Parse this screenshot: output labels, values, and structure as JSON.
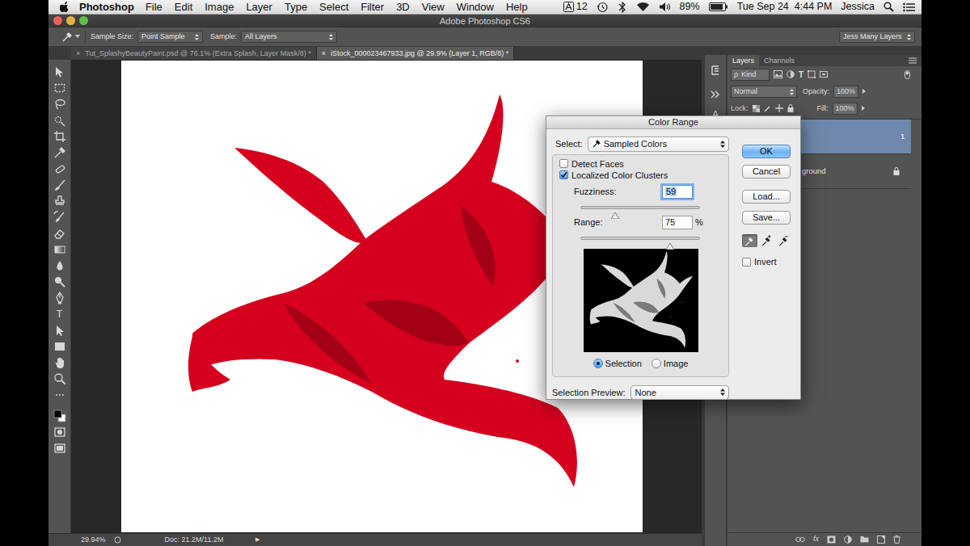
{
  "menubar": {
    "app": "Photoshop",
    "menus": [
      "File",
      "Edit",
      "Image",
      "Layer",
      "Type",
      "Select",
      "Filter",
      "3D",
      "View",
      "Window",
      "Help"
    ],
    "status": {
      "notifications": "12",
      "battery": "89%",
      "clock": "Tue Sep 24  4:44 PM",
      "user": "Jessica"
    }
  },
  "window": {
    "title": "Adobe Photoshop CS6"
  },
  "options_bar": {
    "sample_size_label": "Sample Size:",
    "sample_size": "Point Sample",
    "sample_label": "Sample:",
    "sample": "All Layers",
    "workspace": "Jess Many Layers"
  },
  "tab_close": "×",
  "tabs": [
    {
      "label": "Tut_SplashyBeautyPaint.psd @ 76.1% (Extra Splash, Layer Mask/8) *",
      "selected": false
    },
    {
      "label": "iStock_000023467933.jpg @ 29.9% (Layer 1, RGB/8) *",
      "selected": true
    }
  ],
  "toolbar": {
    "type_tool": "T"
  },
  "status_bar": {
    "zoom": "29.94%",
    "doc": "Doc: 21.2M/11.2M",
    "arrow": "▶"
  },
  "side_strip": {
    "character_icon": "A"
  },
  "layers_panel": {
    "tabs": [
      {
        "label": "Layers",
        "selected": true
      },
      {
        "label": "Channels",
        "selected": false
      }
    ],
    "filter_search": "ρ",
    "filter": "Kind",
    "type_filter": "T",
    "blend_mode": "Normal",
    "opacity_label": "Opacity:",
    "opacity": "100%",
    "lock_label": "Lock:",
    "fill_label": "Fill:",
    "fill": "100%",
    "layers": [
      {
        "name": "1",
        "selected": true,
        "locked": false
      },
      {
        "name": "ground",
        "selected": false,
        "locked": true
      }
    ],
    "footer_fx": "fx"
  },
  "dialog": {
    "title": "Color Range",
    "select_label": "Select:",
    "select": "Sampled Colors",
    "checkboxes": [
      {
        "label": "Detect Faces",
        "checked": false
      },
      {
        "label": "Localized Color Clusters",
        "checked": true
      }
    ],
    "sliders": [
      {
        "label": "Fuzziness:",
        "value": "59",
        "level": 0.29,
        "focused": true
      },
      {
        "label": "Range:",
        "value": "75",
        "unit": "%",
        "level": 0.75,
        "focused": false
      }
    ],
    "preview_modes": [
      {
        "label": "Selection",
        "selected": true
      },
      {
        "label": "Image",
        "selected": false
      }
    ],
    "selection_preview_label": "Selection Preview:",
    "selection_preview": "None",
    "buttons": [
      {
        "label": "OK",
        "default": true
      },
      {
        "label": "Cancel",
        "default": false
      },
      {
        "label": "Load...",
        "default": false
      },
      {
        "label": "Save...",
        "default": false
      }
    ],
    "eyedroppers": [
      {
        "selected": true
      },
      {
        "selected": false
      },
      {
        "selected": false
      }
    ],
    "invert": {
      "label": "Invert",
      "checked": false
    }
  }
}
